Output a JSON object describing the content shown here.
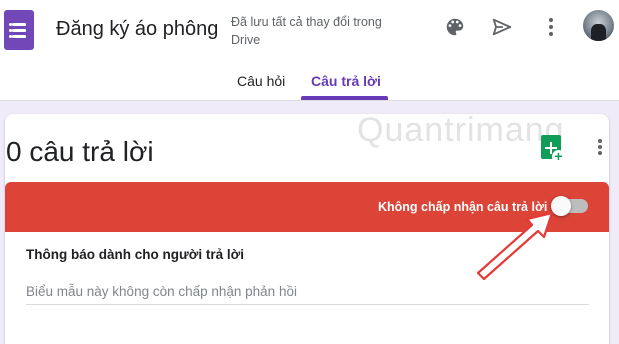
{
  "header": {
    "title": "Đăng ký áo phông",
    "saved_status_line1": "Đã lưu tất cả thay đổi trong",
    "saved_status_line2": "Drive",
    "icons": [
      "palette-icon",
      "send-icon",
      "more-vert-icon"
    ]
  },
  "tabs": [
    {
      "label": "Câu hỏi",
      "active": false
    },
    {
      "label": "Câu trả lời",
      "active": true
    }
  ],
  "responses": {
    "count_label": "0 câu trả lời",
    "accepting_label": "Không chấp nhận câu trả lời",
    "accepting": false,
    "message_title": "Thông báo dành cho người trả lời",
    "message_value": "Biểu mẫu này không còn chấp nhận phản hồi"
  },
  "watermark": "Quantrimang",
  "colors": {
    "brand": "#673ab7",
    "red_bar": "#db4437",
    "sheets": "#0f9d58",
    "background": "#f0ebf8"
  }
}
